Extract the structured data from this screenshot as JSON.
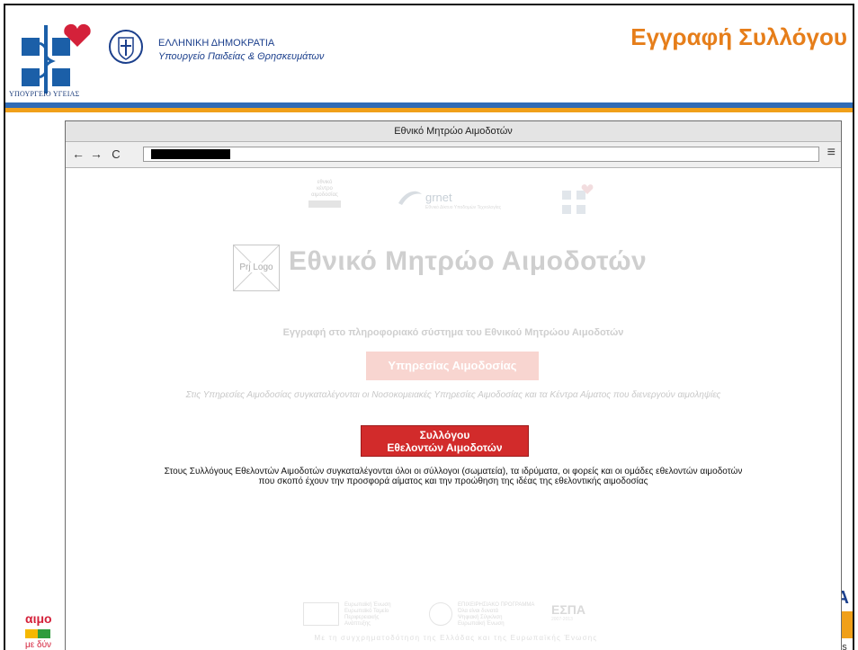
{
  "header": {
    "ministry_caption": "ΥΠΟΥΡΓΕΙΟ ΥΓΕΙΑΣ",
    "republic": "ΕΛΛΗΝΙΚΗ ΔΗΜΟΚΡΑΤΙΑ",
    "ministry_education": "Υπουργείο Παιδείας & Θρησκευμάτων",
    "slide_title": "Εγγραφή Συλλόγου"
  },
  "browser": {
    "window_title": "Εθνικό Μητρώο Αιμοδοτών",
    "nav": {
      "back": "←",
      "forward": "→",
      "reload": "C"
    },
    "menu": "≡"
  },
  "page": {
    "partners": {
      "logo1_lines": [
        "εθνικό",
        "κέντρο",
        "αιμοδοσίας"
      ],
      "grnet_name": "grnet",
      "grnet_tagline": "Εθνικό Δίκτυο Υποδομών Τεχνολογίας"
    },
    "prj_logo": "Prj Logo",
    "registry_title": "Εθνικό Μητρώο Αιμοδοτών",
    "registration_intro": "Εγγραφή στο πληροφοριακό σύστημα του Εθνικού Μητρώου Αιμοδοτών",
    "services_button": "Υπηρεσίας Αιμοδοσίας",
    "services_description": "Στις Υπηρεσίες Αιμοδοσίας συγκαταλέγονται οι Νοσοκομειακές Υπηρεσίες Αιμοδοσίας και τα Κέντρα Αίματος που διενεργούν αιμοληψίες",
    "clubs_button_line1": "Συλλόγου",
    "clubs_button_line2": "Εθελοντών Αιμοδοτών",
    "clubs_description_line1": "Στους Συλλόγους Εθελοντών Αιμοδοτών συγκαταλέγονται όλοι οι σύλλογοι (σωματεία), τα ιδρύματα, οι φορείς και οι ομάδες εθελοντών αιμοδοτών",
    "clubs_description_line2": "που σκοπό έχουν την προσφορά αίματος και την προώθηση της ιδέας της εθελοντικής αιμοδοσίας",
    "footer": {
      "eu_text": [
        "Ευρωπαϊκή Ένωση",
        "Ευρωπαϊκό Ταμείο",
        "Περιφερειακής",
        "Ανάπτυξης"
      ],
      "gr_text": [
        "ΕΠΙΧΕΙΡΗΣΙΑΚΟ ΠΡΟΓΡΑΜΜΑ",
        "Όλα είναι δυνατά",
        "Ψηφιακή Σύγκλιση",
        "Ευρωπαϊκή Ένωση"
      ],
      "espa": "ΕΣΠΑ",
      "espa_years": "2007-2013",
      "cofund_caption": "Με τη συγχρηματοδότηση της Ελλάδας και της Ευρωπαϊκής Ένωσης"
    }
  },
  "slide_peeks": {
    "left_word": "αιμο",
    "left_sub": "με δύν",
    "right_block": "ΙΑ",
    "right_text": "ans"
  },
  "colors": {
    "title_orange": "#e67e1a",
    "stripe_blue": "#2f6bb5",
    "stripe_orange": "#f0a01a",
    "primary_button_red": "#d22b2b",
    "disabled_button_pink": "#f8d5d0",
    "ministry_red": "#d4213a",
    "ministry_blue": "#1b5fa8"
  }
}
